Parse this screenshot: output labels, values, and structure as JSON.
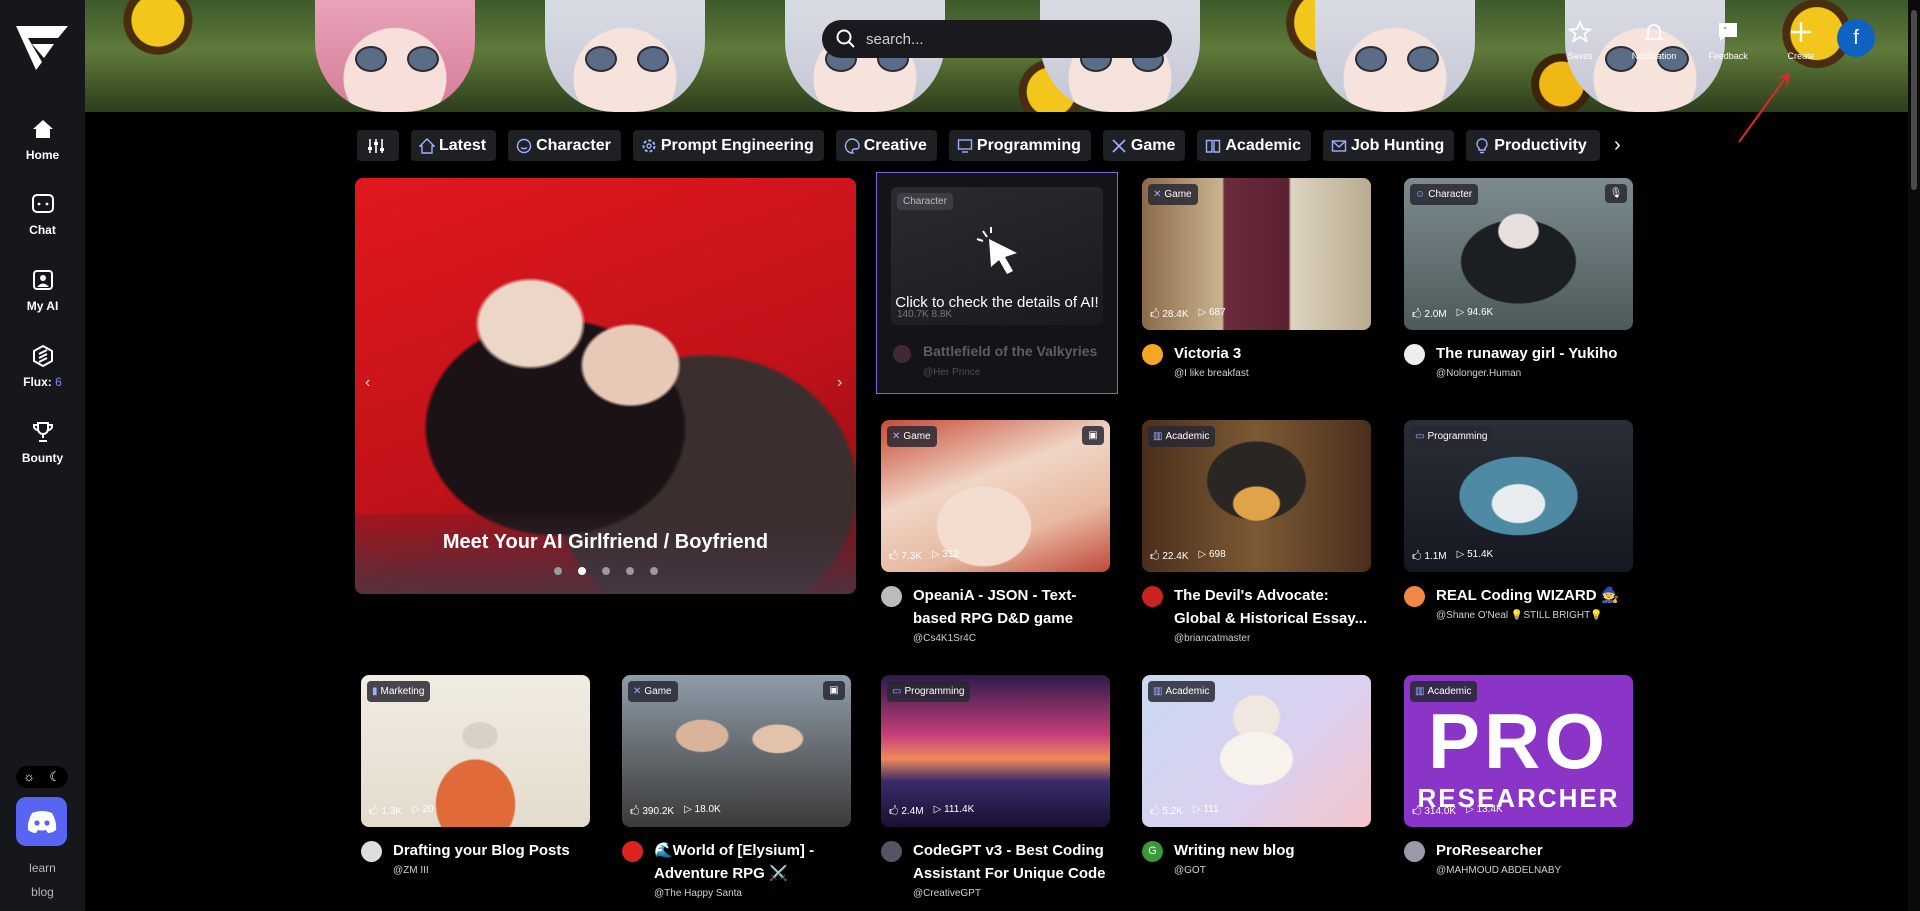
{
  "sidebar": {
    "items": [
      {
        "label": "Home",
        "icon": "home-icon"
      },
      {
        "label": "Chat",
        "icon": "chat-icon"
      },
      {
        "label": "My AI",
        "icon": "my-ai-icon"
      },
      {
        "label": "Flux:",
        "count": "6",
        "icon": "flux-icon"
      },
      {
        "label": "Bounty",
        "icon": "trophy-icon"
      }
    ],
    "links": [
      "learn",
      "blog"
    ]
  },
  "search": {
    "placeholder": "search..."
  },
  "top_actions": [
    "Saves",
    "Notification",
    "Feedback",
    "Create"
  ],
  "user": {
    "initial": "f",
    "color": "#0e63c2"
  },
  "categories": [
    "Latest",
    "Character",
    "Prompt Engineering",
    "Creative",
    "Programming",
    "Game",
    "Academic",
    "Job Hunting",
    "Productivity"
  ],
  "hero": {
    "title": "Meet Your AI Girlfriend / Boyfriend",
    "active_slide": 2,
    "slide_count": 5
  },
  "feature": {
    "badge": "Character",
    "overlay_text": "Click to check the details of AI!",
    "title": "Battlefield of the Valkyries",
    "author": "@Her Prince",
    "stats": "140.7K   8.8K"
  },
  "cards": [
    {
      "category": "Game",
      "likes": "28.4K",
      "plays": "687",
      "title": "Victoria 3",
      "author": "@I like breakfast"
    },
    {
      "category": "Character",
      "likes": "2.0M",
      "plays": "94.6K",
      "title": "The runaway girl - Yukiho",
      "author": "@Nolonger.Human"
    },
    {
      "category": "Game",
      "likes": "7.3K",
      "plays": "312",
      "title": "OpeaniA - JSON - Text-based RPG D&D game wit...",
      "author": "@Cs4K1Sr4C"
    },
    {
      "category": "Academic",
      "likes": "22.4K",
      "plays": "698",
      "title": "The Devil's Advocate: Global & Historical Essay...",
      "author": "@briancatmaster"
    },
    {
      "category": "Programming",
      "likes": "1.1M",
      "plays": "51.4K",
      "title": "REAL Coding WIZARD 🧙",
      "author": "@Shane O'Neal 💡STILL BRIGHT💡"
    },
    {
      "category": "Marketing",
      "likes": "1.3K",
      "plays": "20",
      "title": "Drafting your Blog Posts",
      "author": "@ZM III"
    },
    {
      "category": "Game",
      "likes": "390.2K",
      "plays": "18.0K",
      "title": "🌊World of [Elysium] - Adventure RPG ⚔️",
      "author": "@The Happy Santa"
    },
    {
      "category": "Programming",
      "likes": "2.4M",
      "plays": "111.4K",
      "title": "CodeGPT v3 - Best Coding Assistant For Unique Code",
      "author": "@CreativeGPT"
    },
    {
      "category": "Academic",
      "likes": "5.2K",
      "plays": "111",
      "title": "Writing new blog",
      "author": "@GOT"
    },
    {
      "category": "Academic",
      "likes": "314.0K",
      "plays": "13.4K",
      "title": "ProResearcher",
      "author": "@MAHMOUD ABDELNABY"
    }
  ]
}
